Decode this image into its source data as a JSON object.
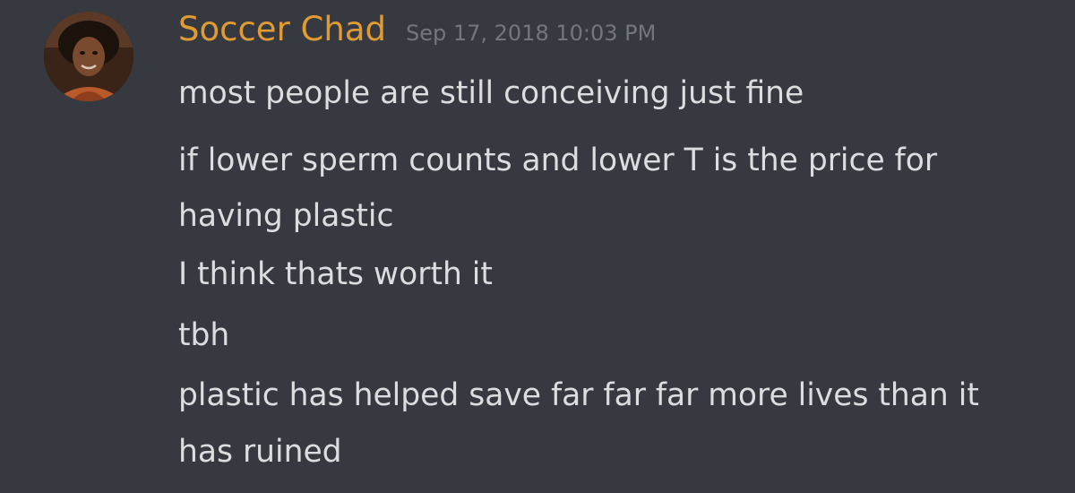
{
  "message": {
    "author": {
      "name": "Soccer Chad",
      "name_color": "#e09b32",
      "avatar": "user-avatar-photo"
    },
    "timestamp": "Sep 17, 2018 10:03 PM",
    "lines": [
      "most people are still conceiving just fine",
      "if lower sperm counts and lower T is the price for",
      "having plastic",
      "I think thats worth it",
      "tbh",
      "plastic has helped save far far far more lives than it",
      "has ruined"
    ]
  },
  "theme": {
    "background": "#36393f",
    "text": "#dcddde",
    "muted": "#72767d"
  }
}
